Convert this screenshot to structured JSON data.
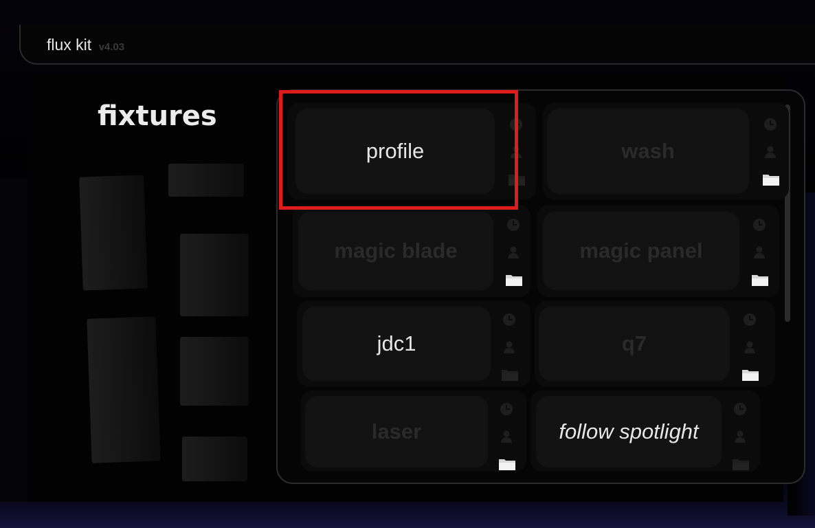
{
  "app": {
    "name": "flux kit",
    "version": "v4.03"
  },
  "section": {
    "title": "fixtures"
  },
  "fixtures": [
    {
      "label": "profile",
      "state": "active"
    },
    {
      "label": "wash",
      "state": "disabled"
    },
    {
      "label": "magic blade",
      "state": "disabled"
    },
    {
      "label": "magic panel",
      "state": "disabled"
    },
    {
      "label": "jdc1",
      "state": "active"
    },
    {
      "label": "q7",
      "state": "disabled"
    },
    {
      "label": "laser",
      "state": "disabled"
    },
    {
      "label": "follow spotlight",
      "state": "active"
    }
  ],
  "icons": [
    "clock-icon",
    "person-icon",
    "folder-icon"
  ],
  "colors": {
    "highlight": "#e01b1b",
    "text": "#e6e6e6",
    "disabled_text": "#2a2a2a"
  }
}
